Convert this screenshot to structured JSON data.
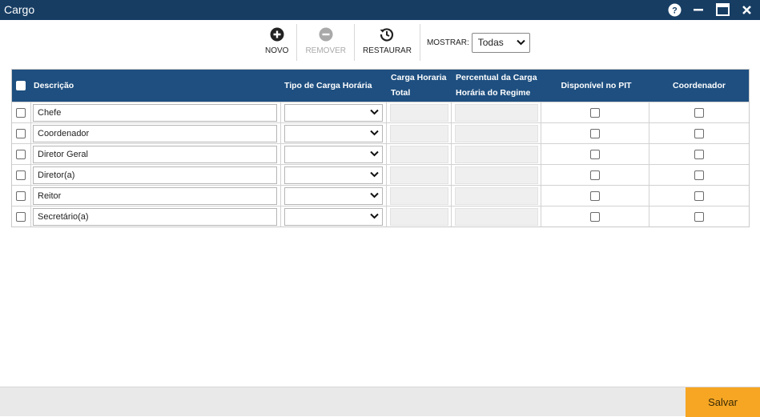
{
  "window": {
    "title": "Cargo"
  },
  "toolbar": {
    "novo": "NOVO",
    "remover": "REMOVER",
    "restaurar": "RESTAURAR",
    "mostrar_label": "MOSTRAR:",
    "mostrar_value": "Todas"
  },
  "table": {
    "headers": {
      "descricao": "Descrição",
      "tipo": "Tipo de Carga Horária",
      "carga_l1": "Carga Horaria",
      "carga_l2": "Total",
      "perc_l1": "Percentual da Carga",
      "perc_l2": "Horária do Regime",
      "pit": "Disponível no PIT",
      "coord": "Coordenador"
    },
    "rows": [
      {
        "descricao": "Chefe"
      },
      {
        "descricao": "Coordenador"
      },
      {
        "descricao": "Diretor Geral"
      },
      {
        "descricao": "Diretor(a)"
      },
      {
        "descricao": "Reitor"
      },
      {
        "descricao": "Secretário(a)"
      }
    ]
  },
  "footer": {
    "save_label": "Salvar"
  },
  "colors": {
    "titlebar": "#173d63",
    "header": "#1e4f80",
    "accent": "#f6a623"
  },
  "icons": [
    "help-icon",
    "minimize-icon",
    "maximize-icon",
    "close-icon",
    "plus-circle-icon",
    "minus-circle-icon",
    "restore-history-icon",
    "chevron-down-icon"
  ]
}
